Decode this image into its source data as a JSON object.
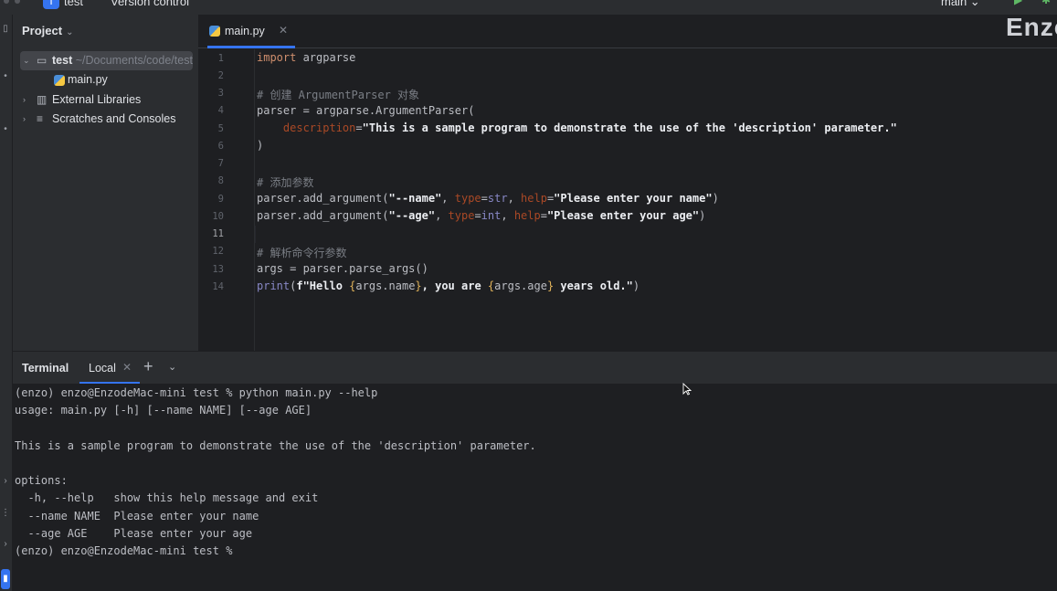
{
  "topbar": {
    "project_badge": "T",
    "project_name": "test",
    "vcs_label": "Version control",
    "branch": "main ⌄",
    "run_icon": "run-icon",
    "debug_icon": "debug-icon"
  },
  "project_panel": {
    "title": "Project",
    "root": {
      "name": "test",
      "path": "~/Documents/code/test"
    },
    "file": "main.py",
    "external_libraries": "External Libraries",
    "scratches": "Scratches and Consoles"
  },
  "editor": {
    "tab_name": "main.py",
    "watermark": "Enzo",
    "current_line": 11,
    "line_numbers": [
      "1",
      "2",
      "3",
      "4",
      "5",
      "6",
      "7",
      "8",
      "9",
      "10",
      "11",
      "12",
      "13",
      "14"
    ]
  },
  "code": {
    "l1_kw": "import",
    "l1_rest": " argparse",
    "l3": "# 创建 ArgumentParser 对象",
    "l4": "parser = argparse.ArgumentParser(",
    "l5_param": "description",
    "l5_eq": "=",
    "l5_str": "\"This is a sample program to demonstrate the use of the 'description' parameter.\"",
    "l6": ")",
    "l8": "# 添加参数",
    "l9_a": "parser.add_argument(",
    "l9_s1": "\"--name\"",
    "l9_sep1": ", ",
    "l9_p1": "type",
    "l9_eq1": "=",
    "l9_bi": "str",
    "l9_sep2": ", ",
    "l9_p2": "help",
    "l9_eq2": "=",
    "l9_s2": "\"Please enter your name\"",
    "l9_end": ")",
    "l10_a": "parser.add_argument(",
    "l10_s1": "\"--age\"",
    "l10_sep1": ", ",
    "l10_p1": "type",
    "l10_eq1": "=",
    "l10_bi": "int",
    "l10_sep2": ", ",
    "l10_p2": "help",
    "l10_eq2": "=",
    "l10_s2": "\"Please enter your age\"",
    "l10_end": ")",
    "l12": "# 解析命令行参数",
    "l13": "args = parser.parse_args()",
    "l14_fn": "print",
    "l14_a": "(",
    "l14_s1": "f\"Hello ",
    "l14_b1": "{",
    "l14_v1": "args.name",
    "l14_b2": "}",
    "l14_s2": ", you are ",
    "l14_b3": "{",
    "l14_v2": "args.age",
    "l14_b4": "}",
    "l14_s3": " years old.\"",
    "l14_end": ")"
  },
  "terminal": {
    "title": "Terminal",
    "tab": "Local",
    "lines": [
      "(enzo) enzo@EnzodeMac-mini test % python main.py --help",
      "usage: main.py [-h] [--name NAME] [--age AGE]",
      "",
      "This is a sample program to demonstrate the use of the 'description' parameter.",
      "",
      "options:",
      "  -h, --help   show this help message and exit",
      "  --name NAME  Please enter your name",
      "  --age AGE    Please enter your age",
      "(enzo) enzo@EnzodeMac-mini test %"
    ]
  },
  "colors": {
    "accent": "#3574f0",
    "keyword": "#cf8e6d",
    "comment": "#7a7e85",
    "param": "#aa4926",
    "builtin": "#8888c6",
    "background": "#1e1f22",
    "panel": "#2b2d30"
  }
}
